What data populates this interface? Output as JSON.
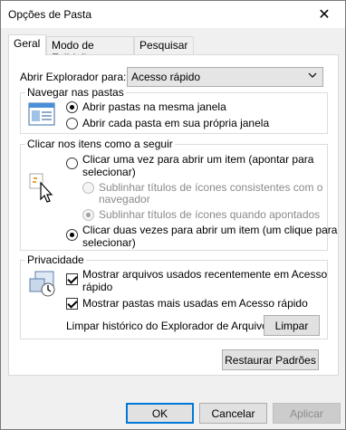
{
  "window": {
    "title": "Opções de Pasta",
    "close_glyph": "✕"
  },
  "tabs": [
    "Geral",
    "Modo de Exibição",
    "Pesquisar"
  ],
  "open_explorer": {
    "label": "Abrir Explorador para:",
    "value": "Acesso rápido"
  },
  "browse": {
    "title": "Navegar nas pastas",
    "option1": "Abrir pastas na mesma janela",
    "option2": "Abrir cada pasta em sua própria janela"
  },
  "click": {
    "title": "Clicar nos itens como a seguir",
    "single_line1": "Clicar uma vez para abrir um item (apontar para",
    "single_line2": "selecionar)",
    "underline_browser_line1": "Sublinhar títulos de ícones consistentes com o",
    "underline_browser_line2": "navegador",
    "underline_point": "Sublinhar títulos de ícones quando apontados",
    "double_line1": "Clicar duas vezes para abrir um item (um clique para",
    "double_line2": "selecionar)"
  },
  "privacy": {
    "title": "Privacidade",
    "recent_line1": "Mostrar arquivos usados recentemente em Acesso",
    "recent_line2": "rápido",
    "frequent": "Mostrar pastas mais usadas em Acesso rápido",
    "clear_label": "Limpar histórico do Explorador de Arquivos",
    "clear_button": "Limpar"
  },
  "restore_button": "Restaurar Padrões",
  "footer": {
    "ok": "OK",
    "cancel": "Cancelar",
    "apply": "Aplicar"
  },
  "icons": [
    "close-icon",
    "folder-window-icon",
    "cursor-click-icon",
    "privacy-icon",
    "dropdown-chevron-icon"
  ]
}
